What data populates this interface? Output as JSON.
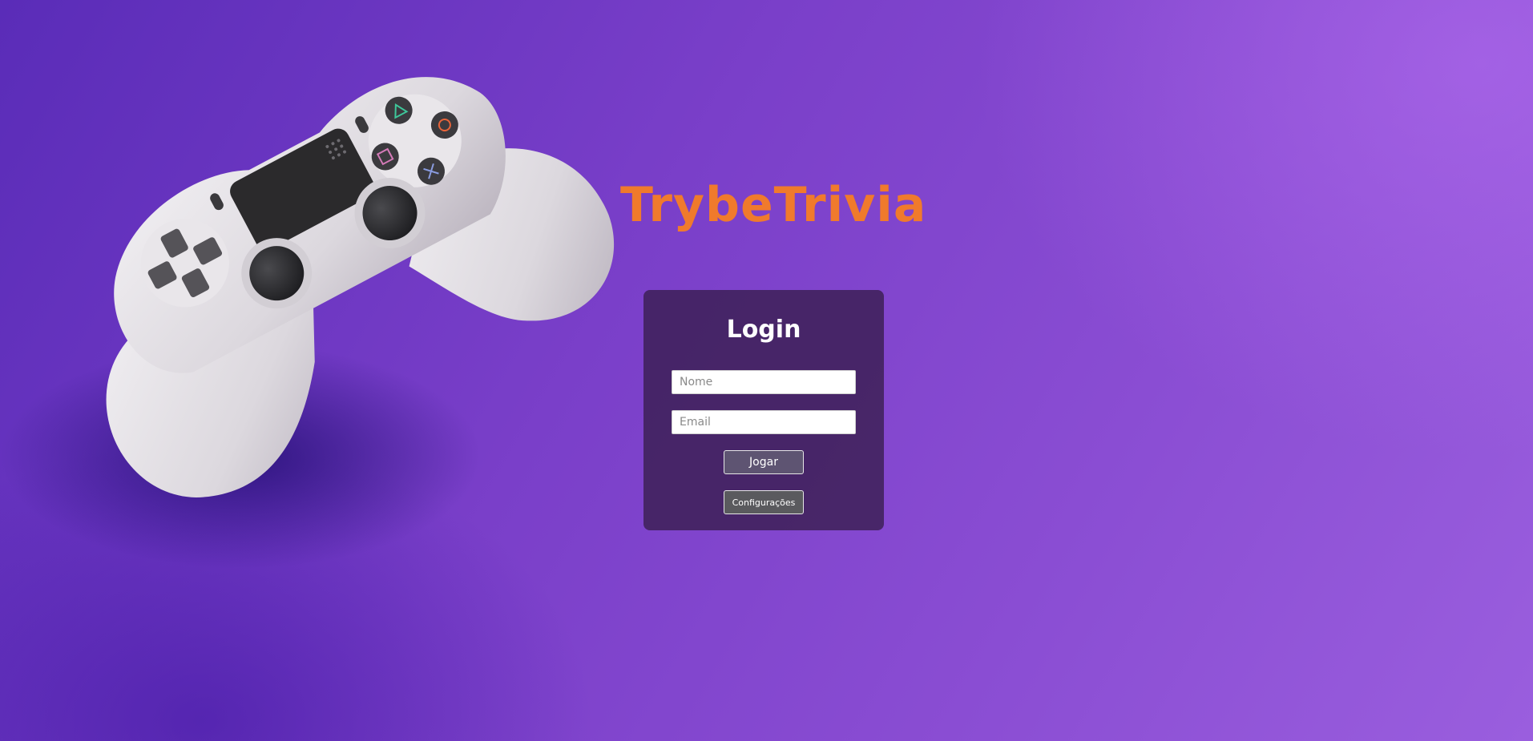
{
  "app": {
    "title": "TrybeTrivia"
  },
  "login": {
    "heading": "Login",
    "name_placeholder": "Nome",
    "email_placeholder": "Email",
    "play_label": "Jogar",
    "settings_label": "Configurações"
  },
  "colors": {
    "title_accent": "#f07a2c",
    "card_background": "#3a1e52",
    "page_background": "#7a3fc9"
  },
  "icons": {
    "background_image": "game-controller-icon"
  }
}
